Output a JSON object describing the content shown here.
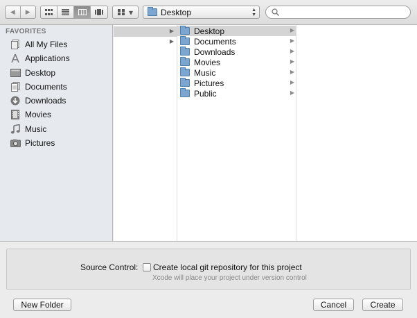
{
  "toolbar": {
    "back_glyph": "◀",
    "forward_glyph": "▶",
    "path": "Desktop",
    "arrange_chevron": "▾",
    "search_placeholder": "",
    "view_modes": [
      "icon-view-icon",
      "list-view-icon",
      "column-view-icon",
      "coverflow-view-icon"
    ],
    "active_view": "column-view-icon"
  },
  "sidebar": {
    "header": "FAVORITES",
    "items": [
      {
        "label": "All My Files",
        "icon": "all-my-files-icon"
      },
      {
        "label": "Applications",
        "icon": "applications-icon"
      },
      {
        "label": "Desktop",
        "icon": "desktop-icon"
      },
      {
        "label": "Documents",
        "icon": "documents-icon"
      },
      {
        "label": "Downloads",
        "icon": "downloads-icon"
      },
      {
        "label": "Movies",
        "icon": "movies-icon"
      },
      {
        "label": "Music",
        "icon": "music-icon"
      },
      {
        "label": "Pictures",
        "icon": "pictures-icon"
      }
    ]
  },
  "browser": {
    "column1_triangle": "▶",
    "folders": [
      {
        "name": "Desktop",
        "selected": true
      },
      {
        "name": "Documents",
        "selected": false
      },
      {
        "name": "Downloads",
        "selected": false
      },
      {
        "name": "Movies",
        "selected": false
      },
      {
        "name": "Music",
        "selected": false
      },
      {
        "name": "Pictures",
        "selected": false
      },
      {
        "name": "Public",
        "selected": false
      }
    ],
    "disclosure_glyph": "▶"
  },
  "source_control": {
    "label": "Source Control:",
    "checkbox_label": "Create local git repository for this project",
    "checked": false,
    "hint": "Xcode will place your project under version control"
  },
  "buttons": {
    "new_folder": "New Folder",
    "cancel": "Cancel",
    "create": "Create"
  },
  "colors": {
    "folder": "#7ca6cf",
    "selection": "#d4d4d4",
    "sidebar_bg": "#e6e9ee"
  }
}
